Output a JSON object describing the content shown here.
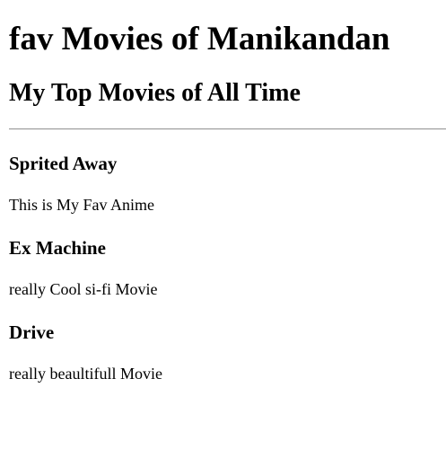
{
  "page": {
    "title": "fav Movies of Manikandan",
    "subtitle": "My Top Movies of All Time"
  },
  "movies": [
    {
      "name": "Sprited Away",
      "description": "This is My Fav Anime"
    },
    {
      "name": "Ex Machine",
      "description": "really Cool si-fi Movie"
    },
    {
      "name": "Drive",
      "description": "really beaultifull Movie"
    }
  ]
}
